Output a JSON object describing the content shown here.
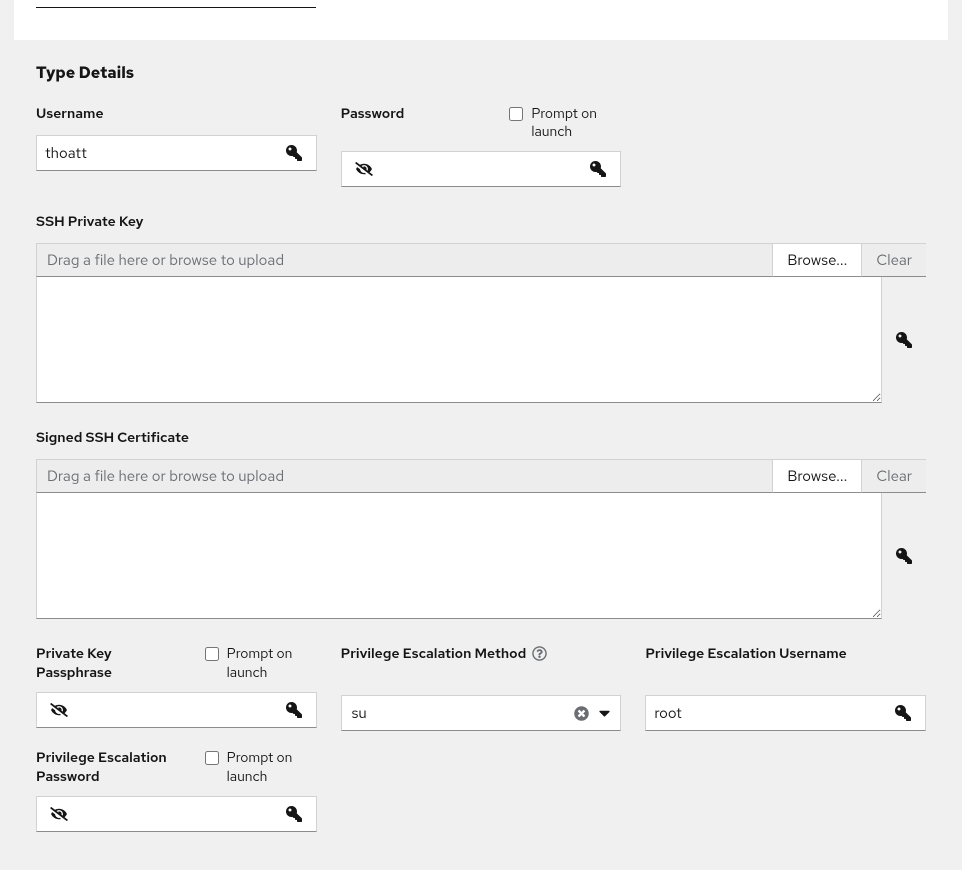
{
  "section_title": "Type Details",
  "username": {
    "label": "Username",
    "value": "thoatt"
  },
  "password": {
    "label": "Password",
    "prompt_label": "Prompt on launch",
    "value": ""
  },
  "ssh_private_key": {
    "label": "SSH Private Key",
    "drop_text": "Drag a file here or browse to upload",
    "browse_label": "Browse...",
    "clear_label": "Clear",
    "value": ""
  },
  "signed_ssh_cert": {
    "label": "Signed SSH Certificate",
    "drop_text": "Drag a file here or browse to upload",
    "browse_label": "Browse...",
    "clear_label": "Clear",
    "value": ""
  },
  "private_key_passphrase": {
    "label": "Private Key Passphrase",
    "prompt_label": "Prompt on launch",
    "value": ""
  },
  "priv_esc_method": {
    "label": "Privilege Escalation Method",
    "value": "su"
  },
  "priv_esc_username": {
    "label": "Privilege Escalation Username",
    "value": "root"
  },
  "priv_esc_password": {
    "label": "Privilege Escalation Password",
    "prompt_label": "Prompt on launch",
    "value": ""
  }
}
